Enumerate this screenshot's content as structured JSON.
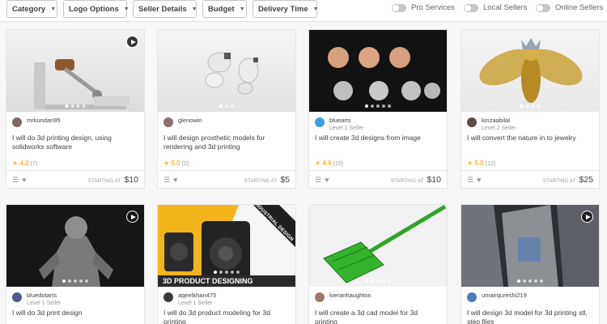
{
  "filters": [
    {
      "label": "Category"
    },
    {
      "label": "Logo Options"
    },
    {
      "label": "Seller Details"
    },
    {
      "label": "Budget"
    },
    {
      "label": "Delivery Time"
    }
  ],
  "toggles": [
    {
      "label": "Pro Services"
    },
    {
      "label": "Local Sellers"
    },
    {
      "label": "Online Sellers"
    }
  ],
  "gigs": [
    {
      "seller": "mrkundan95",
      "level": "",
      "title": "I will do 3d printing design, using solidworks software",
      "rating": "4.2",
      "reviews": "(7)",
      "starting": "STARTING AT",
      "price": "$10",
      "video": true
    },
    {
      "seller": "glenowin",
      "level": "",
      "title": "I will design prosthetic models for rendering and 3d printing",
      "rating": "5.0",
      "reviews": "(2)",
      "starting": "STARTING AT",
      "price": "$5",
      "video": false
    },
    {
      "seller": "bluearts",
      "level": "Level 1 Seller",
      "title": "I will create 3d designs from image",
      "rating": "4.9",
      "reviews": "(15)",
      "starting": "STARTING AT",
      "price": "$10",
      "video": false
    },
    {
      "seller": "kinzaabilal",
      "level": "Level 2 Seller",
      "title": "I will convert the nature in to jewelry",
      "rating": "5.0",
      "reviews": "(12)",
      "starting": "STARTING AT",
      "price": "$25",
      "video": false
    },
    {
      "seller": "bluedotarts",
      "level": "Level 1 Seller",
      "title": "I will do 3d print design",
      "video": true
    },
    {
      "seller": "aqeelkhan475",
      "level": "Level 1 Seller",
      "title": "I will do 3d product modeling for 3d printing",
      "banner": "INDUSTRIAL DESIGN",
      "caption": "3D PRODUCT DESIGNING",
      "video": false
    },
    {
      "seller": "kieranhaughton",
      "level": "",
      "title": "I will create a 3d cad model for 3d printing",
      "video": false
    },
    {
      "seller": "umairqureshi219",
      "level": "",
      "title": "I will design 3d model for 3d printing stl, step files",
      "video": true
    }
  ],
  "colors": {
    "star": "#ffb33e",
    "text": "#404145",
    "muted": "#95979d",
    "border": "#e4e5e7"
  }
}
